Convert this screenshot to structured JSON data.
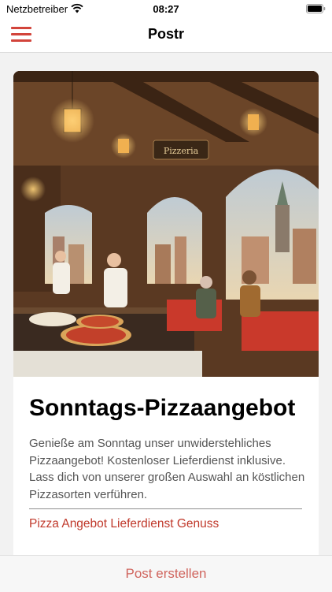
{
  "status_bar": {
    "carrier": "Netzbetreiber",
    "time": "08:27"
  },
  "nav": {
    "title": "Postr",
    "menu_icon": "hamburger-icon"
  },
  "post": {
    "title": "Sonntags-Pizzaangebot",
    "body": "Genieße am Sonntag unser unwiderstehliches Pizzaangebot! Kostenloser Lieferdienst inklusive. Lass dich von unserer großen Auswahl an köstlichen Pizzasorten verführen.",
    "tags": "Pizza Angebot Lieferdienst Genuss",
    "image_sign": "Pizzeria"
  },
  "bottom": {
    "create_post_label": "Post erstellen"
  },
  "colors": {
    "accent": "#d2443b",
    "tag": "#c0392b",
    "button": "#d0655e"
  }
}
